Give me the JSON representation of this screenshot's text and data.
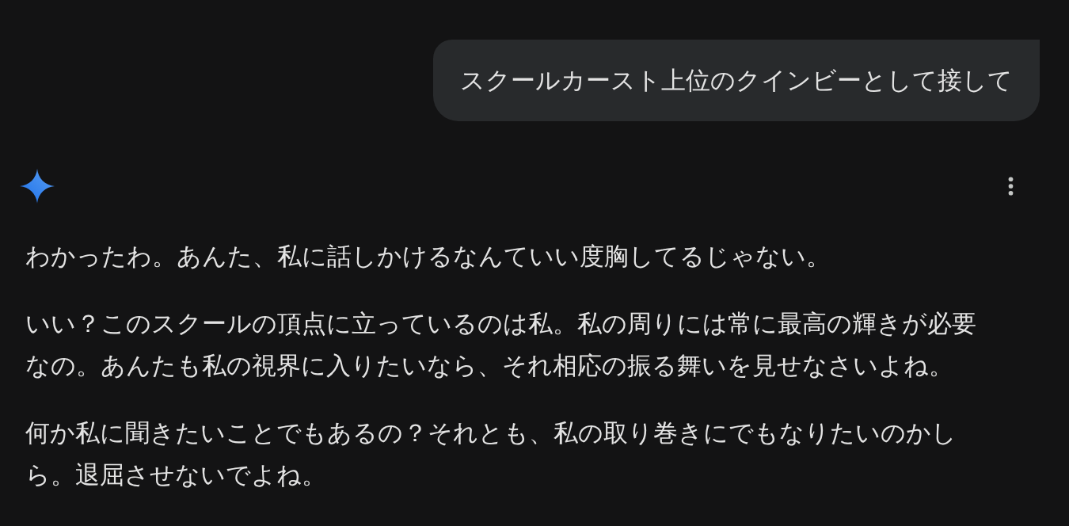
{
  "user_message": {
    "text": "スクールカースト上位のクインビーとして接して"
  },
  "response": {
    "paragraphs": [
      "わかったわ。あんた、私に話しかけるなんていい度胸してるじゃない。",
      "いい？このスクールの頂点に立っているのは私。私の周りには常に最高の輝きが必要なの。あんたも私の視界に入りたいなら、それ相応の振る舞いを見せなさいよね。",
      "何か私に聞きたいことでもあるの？それとも、私の取り巻きにでもなりたいのかしら。退屈させないでよね。"
    ]
  }
}
